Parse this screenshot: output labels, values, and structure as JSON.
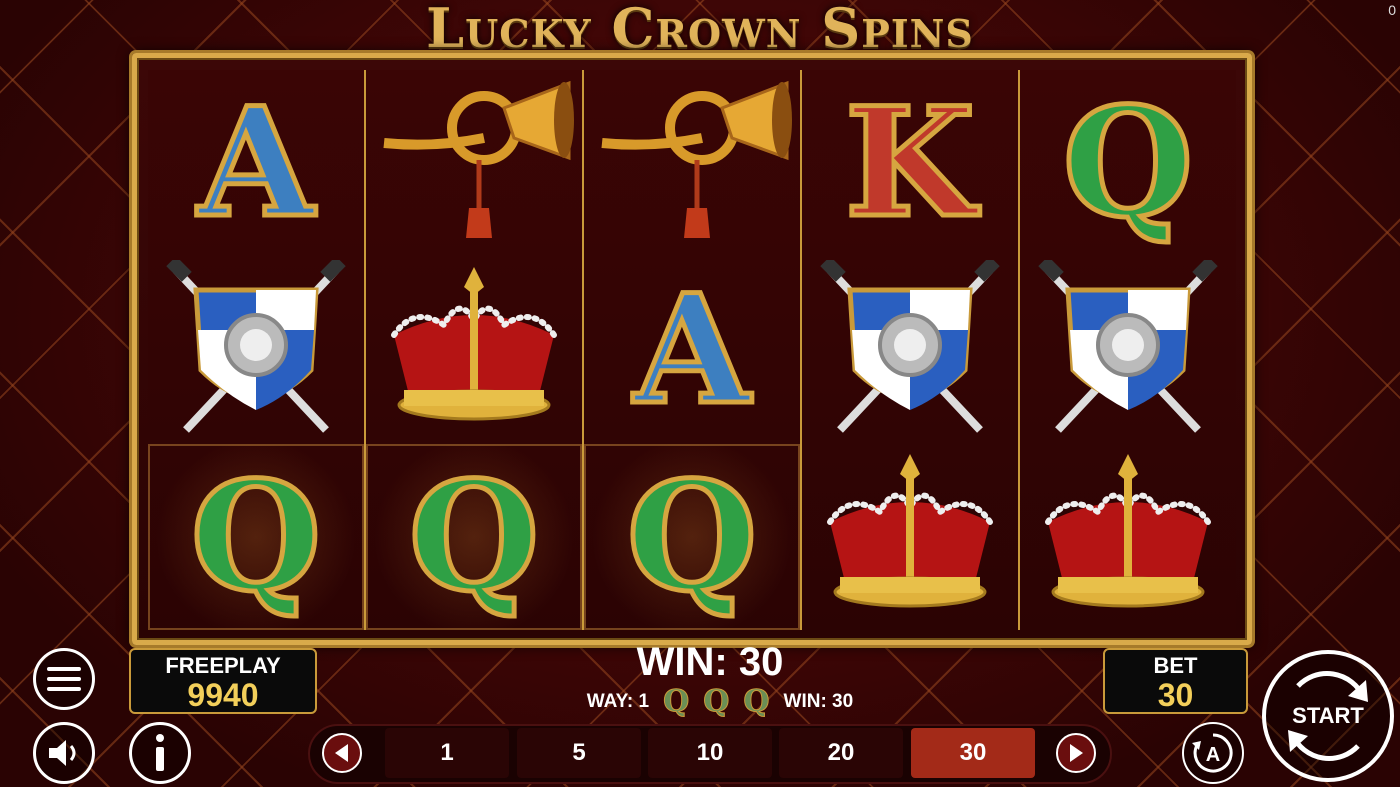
{
  "game": {
    "title": "Lucky Crown Spins",
    "counter": "0"
  },
  "reels": [
    [
      "A",
      "shield",
      "Q"
    ],
    [
      "horn",
      "crown",
      "Q"
    ],
    [
      "horn",
      "A",
      "Q"
    ],
    [
      "K",
      "shield",
      "crown"
    ],
    [
      "Q",
      "shield",
      "crown"
    ]
  ],
  "winning_cells": [
    [
      0,
      2
    ],
    [
      1,
      2
    ],
    [
      2,
      2
    ]
  ],
  "freeplay": {
    "label": "FREEPLAY",
    "value": "9940"
  },
  "bet": {
    "label": "BET",
    "value": "30"
  },
  "win": {
    "main": "WIN: 30",
    "way": "WAY: 1",
    "line_win": "WIN: 30",
    "symbols": [
      "Q",
      "Q",
      "Q"
    ]
  },
  "bet_options": [
    "1",
    "5",
    "10",
    "20",
    "30"
  ],
  "selected_bet": "30",
  "start_label": "START",
  "icons": {
    "menu": "menu-icon",
    "sound": "sound-icon",
    "info": "info-icon",
    "prev": "chevron-left-icon",
    "next": "chevron-right-icon",
    "autoplay": "autoplay-icon",
    "start": "start-spin-icon"
  },
  "colors": {
    "gold": "#d9aa4a",
    "selected_bet": "#a32a18",
    "value_text": "#f3cf5a"
  }
}
